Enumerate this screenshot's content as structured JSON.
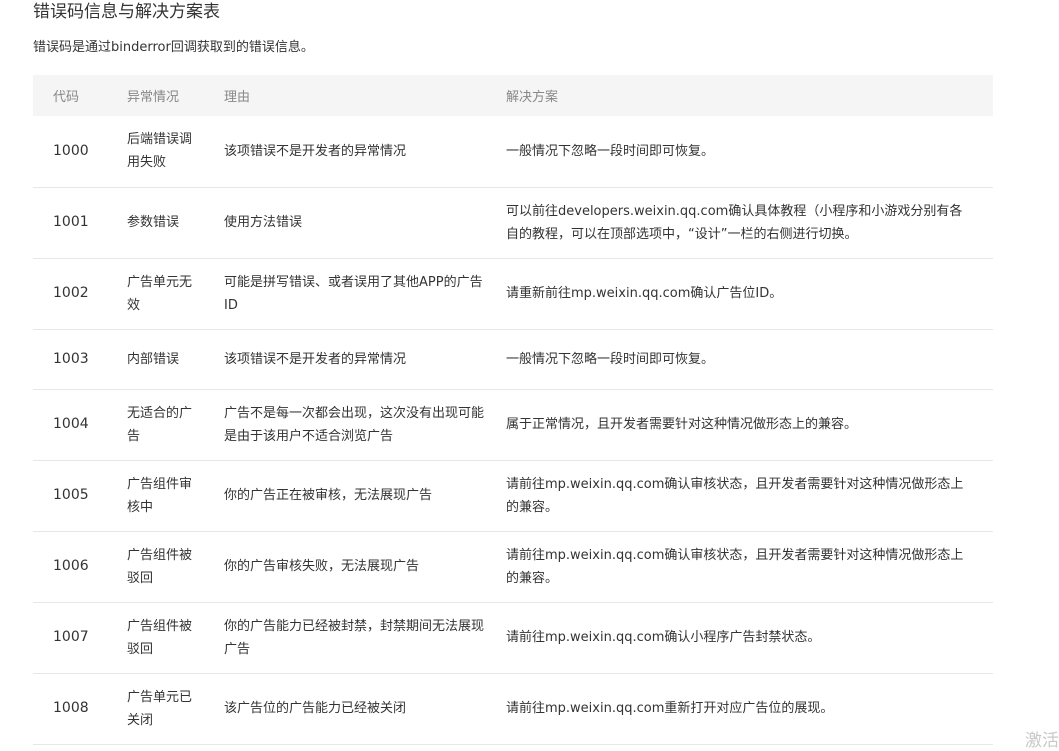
{
  "page": {
    "title": "错误码信息与解决方案表",
    "description": "错误码是通过binderror回调获取到的错误信息。"
  },
  "table": {
    "headers": [
      "代码",
      "异常情况",
      "理由",
      "解决方案"
    ],
    "rows": [
      {
        "code": "1000",
        "case": "后端错误调用失败",
        "reason": "该项错误不是开发者的异常情况",
        "solution": "一般情况下忽略一段时间即可恢复。"
      },
      {
        "code": "1001",
        "case": "参数错误",
        "reason": "使用方法错误",
        "solution": "可以前往developers.weixin.qq.com确认具体教程（小程序和小游戏分别有各自的教程，可以在顶部选项中，“设计”一栏的右侧进行切换。"
      },
      {
        "code": "1002",
        "case": "广告单元无效",
        "reason": "可能是拼写错误、或者误用了其他APP的广告ID",
        "solution": "请重新前往mp.weixin.qq.com确认广告位ID。"
      },
      {
        "code": "1003",
        "case": "内部错误",
        "reason": "该项错误不是开发者的异常情况",
        "solution": "一般情况下忽略一段时间即可恢复。"
      },
      {
        "code": "1004",
        "case": "无适合的广告",
        "reason": "广告不是每一次都会出现，这次没有出现可能是由于该用户不适合浏览广告",
        "solution": "属于正常情况，且开发者需要针对这种情况做形态上的兼容。"
      },
      {
        "code": "1005",
        "case": "广告组件审核中",
        "reason": "你的广告正在被审核，无法展现广告",
        "solution": "请前往mp.weixin.qq.com确认审核状态，且开发者需要针对这种情况做形态上的兼容。"
      },
      {
        "code": "1006",
        "case": "广告组件被驳回",
        "reason": "你的广告审核失败，无法展现广告",
        "solution": "请前往mp.weixin.qq.com确认审核状态，且开发者需要针对这种情况做形态上的兼容。"
      },
      {
        "code": "1007",
        "case": "广告组件被驳回",
        "reason": "你的广告能力已经被封禁，封禁期间无法展现广告",
        "solution": "请前往mp.weixin.qq.com确认小程序广告封禁状态。"
      },
      {
        "code": "1008",
        "case": "广告单元已关闭",
        "reason": "该广告位的广告能力已经被关闭",
        "solution": "请前往mp.weixin.qq.com重新打开对应广告位的展现。"
      }
    ]
  },
  "watermark": "激活"
}
